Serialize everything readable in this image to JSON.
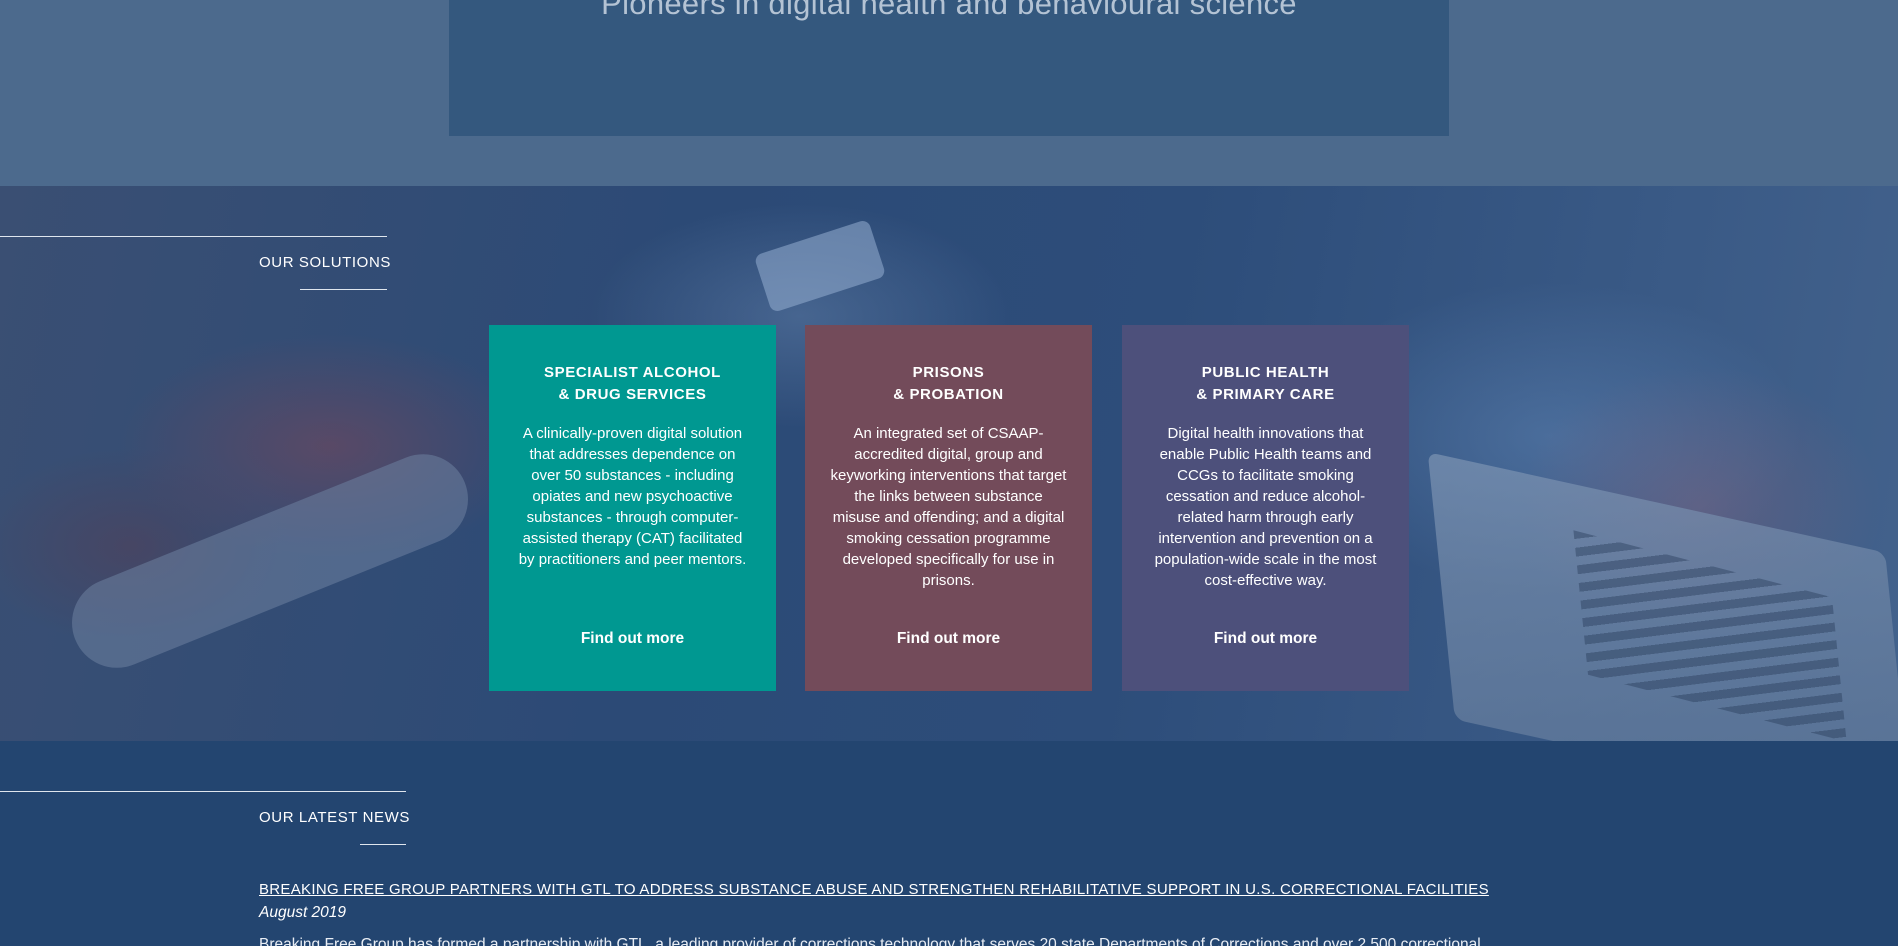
{
  "hero": {
    "tagline": "Pioneers in digital health and behavioural science"
  },
  "solutions": {
    "heading": "OUR SOLUTIONS",
    "cards": [
      {
        "title_line1": "SPECIALIST ALCOHOL",
        "title_line2": "& DRUG SERVICES",
        "description": "A clinically-proven digital solution that addresses dependence on over 50 substances - including opiates and new psychoactive substances - through computer-assisted therapy (CAT) facilitated by practitioners and peer mentors.",
        "link": "Find out more",
        "color": "#009891"
      },
      {
        "title_line1": "PRISONS",
        "title_line2": "& PROBATION",
        "description": "An integrated set of CSAAP-accredited digital, group and keyworking interventions that target the links between substance misuse and offending; and a digital smoking cessation programme developed specifically for use in prisons.",
        "link": "Find out more",
        "color": "#734b5a"
      },
      {
        "title_line1": "PUBLIC HEALTH",
        "title_line2": "& PRIMARY CARE",
        "description": "Digital health innovations that enable Public Health teams and CCGs to facilitate smoking cessation and reduce alcohol-related harm through early intervention and prevention on a population-wide scale in the most cost-effective way.",
        "link": "Find out more",
        "color": "#4d507b"
      }
    ]
  },
  "news": {
    "heading": "OUR LATEST NEWS",
    "items": [
      {
        "headline": "BREAKING FREE GROUP PARTNERS WITH GTL TO ADDRESS SUBSTANCE ABUSE AND STRENGTHEN REHABILITATIVE SUPPORT IN U.S. CORRECTIONAL FACILITIES",
        "date": "August 2019",
        "snippet": "Breaking Free Group has formed a partnership with GTL, a leading provider of corrections technology that serves 20 state Departments of Corrections and over 2,500 correctional"
      }
    ]
  }
}
